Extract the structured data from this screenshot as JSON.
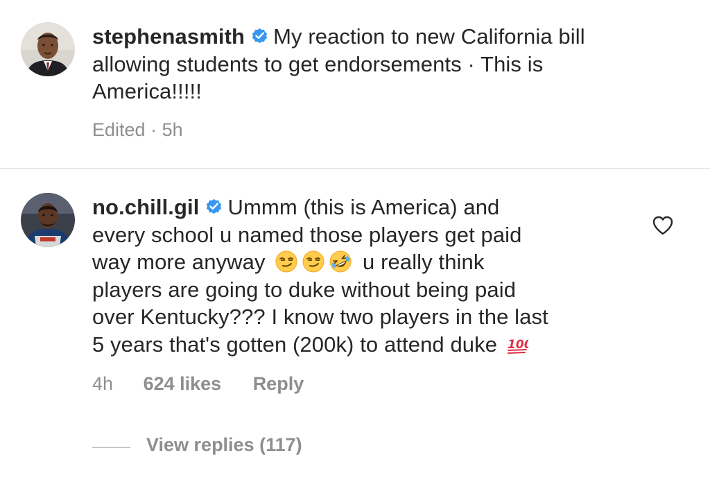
{
  "comment_1": {
    "username": "stephenasmith",
    "text_line1": "My reaction to new California bill",
    "text_line2": "allowing students to get endorsements · This is",
    "text_line3": "America!!!!!",
    "edited_label": "Edited",
    "time": "5h"
  },
  "comment_2": {
    "username": "no.chill.gil",
    "text_line1": "Ummm (this is America) and",
    "text_line2": "every school u named those players get paid",
    "text_line3a": "way more anyway",
    "text_line3b": "u really think",
    "text_line4": "players are going to duke without being paid",
    "text_line5": "over Kentucky??? I know two players in the last",
    "text_line6": "5 years that's gotten (200k) to attend duke",
    "time": "4h",
    "likes": "624 likes",
    "reply_label": "Reply",
    "view_replies_label": "View replies (117)"
  },
  "icons": {
    "verified": "verified-badge-icon",
    "heart": "heart-outline-icon",
    "emoji_smirk": "smirk-emoji-icon",
    "emoji_rofl": "rolling-laughing-emoji-icon",
    "emoji_hundred": "hundred-points-emoji-icon"
  },
  "colors": {
    "text": "#262626",
    "muted": "#8e8e8e",
    "verified_blue": "#3897f0",
    "divider": "#dbdbdb"
  }
}
